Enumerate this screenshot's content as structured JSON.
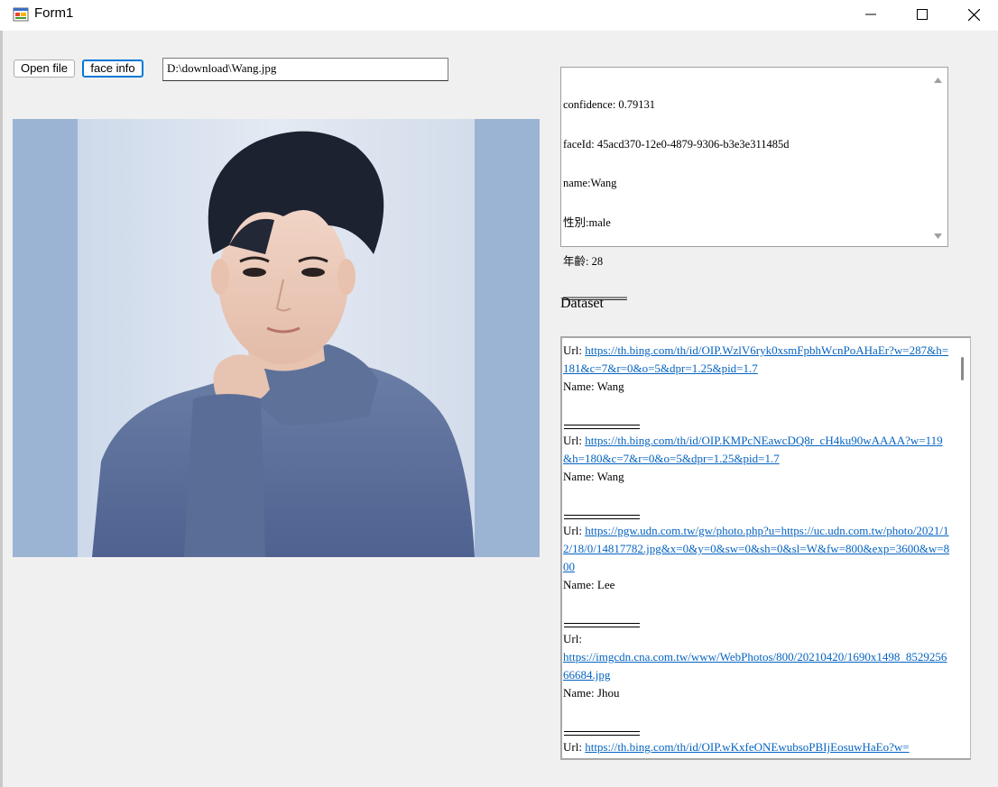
{
  "window": {
    "title": "Form1",
    "icon": "winforms-app-icon",
    "controls": [
      "minimize-icon",
      "maximize-icon",
      "close-icon"
    ]
  },
  "toolbar": {
    "open_file_label": "Open file",
    "face_info_label": "face info",
    "path_value": "D:\\download\\Wang.jpg"
  },
  "photo": {
    "description": "",
    "background_color": "#9cb4d4"
  },
  "info": {
    "lines": [
      "confidence: 0.79131",
      "faceId: 45acd370-12e0-4879-9306-b3e3e311485d",
      "name:Wang",
      "性別:male",
      "年齡: 28",
      "════════"
    ]
  },
  "dataset": {
    "label": "Dataset",
    "url_label": "Url:",
    "entries": [
      {
        "url": "https://th.bing.com/th/id/OIP.WzlV6ryk0xsmFpbhWcnPoAHaEr?w=287&h=181&c=7&r=0&o=5&dpr=1.25&pid=1.7",
        "name": "Name: Wang"
      },
      {
        "url": "https://th.bing.com/th/id/OIP.KMPcNEawcDQ8r_cH4ku90wAAAA?w=119&h=180&c=7&r=0&o=5&dpr=1.25&pid=1.7",
        "name": "Name: Wang"
      },
      {
        "url": "https://pgw.udn.com.tw/gw/photo.php?u=https://uc.udn.com.tw/photo/2021/12/18/0/14817782.jpg&x=0&y=0&sw=0&sh=0&sl=W&fw=800&exp=3600&w=800",
        "name": "Name: Lee"
      },
      {
        "url": "https://imgcdn.cna.com.tw/www/WebPhotos/800/20210420/1690x1498_852925666684.jpg",
        "name": "Name: Jhou"
      },
      {
        "url": "https://th.bing.com/th/id/OIP.wKxfeONEwubsoPBIjEosuwHaEo?w=",
        "name": ""
      }
    ]
  },
  "colors": {
    "focus_border": "#0078d7",
    "link": "#0563c1",
    "window_bg": "#f0f0f0"
  }
}
